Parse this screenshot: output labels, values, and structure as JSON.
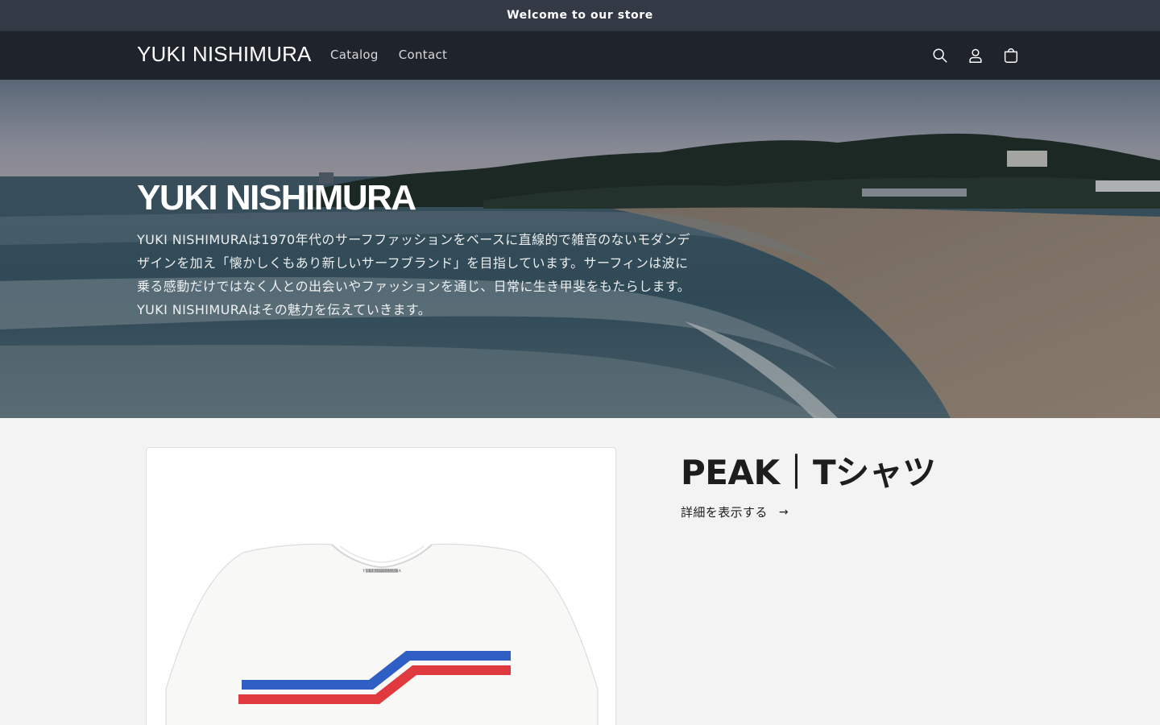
{
  "announcement": {
    "text": "Welcome to our store"
  },
  "header": {
    "logo": "YUKI NISHIMURA",
    "nav": [
      {
        "label": "Catalog"
      },
      {
        "label": "Contact"
      }
    ],
    "icons": [
      "search-icon",
      "account-icon",
      "cart-icon"
    ]
  },
  "hero": {
    "title": "YUKI NISHIMURA",
    "description": "YUKI NISHIMURAは1970年代のサーフファッションをベースに直線的で雑音のないモダンデザインを加え「懐かしくもあり新しいサーフブランド」を目指しています。サーフィンは波に乗る感動だけではなく人との出会いやファッションを通じ、日常に生き甲斐をもたらします。YUKI NISHIMURAはその魅力を伝えていきます。"
  },
  "featured_product": {
    "title": "PEAK｜Tシャツ",
    "details_link": "詳細を表示する",
    "arrow": "→",
    "image_tag_text": "YUKI NISHIMURA"
  },
  "colors": {
    "announcement_bg": "#333a45",
    "header_bg": "#1f232b",
    "page_bg": "#f3f3f3",
    "stripe_blue": "#2f5fc4",
    "stripe_red": "#e03a3e"
  }
}
